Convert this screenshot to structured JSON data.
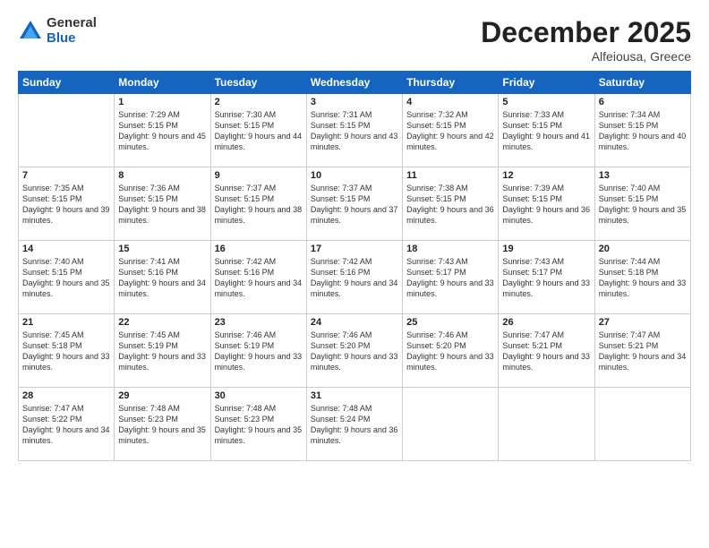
{
  "logo": {
    "general": "General",
    "blue": "Blue"
  },
  "title": "December 2025",
  "location": "Alfeiousa, Greece",
  "days_header": [
    "Sunday",
    "Monday",
    "Tuesday",
    "Wednesday",
    "Thursday",
    "Friday",
    "Saturday"
  ],
  "weeks": [
    [
      {
        "day": "",
        "sunrise": "",
        "sunset": "",
        "daylight": ""
      },
      {
        "day": "1",
        "sunrise": "Sunrise: 7:29 AM",
        "sunset": "Sunset: 5:15 PM",
        "daylight": "Daylight: 9 hours and 45 minutes."
      },
      {
        "day": "2",
        "sunrise": "Sunrise: 7:30 AM",
        "sunset": "Sunset: 5:15 PM",
        "daylight": "Daylight: 9 hours and 44 minutes."
      },
      {
        "day": "3",
        "sunrise": "Sunrise: 7:31 AM",
        "sunset": "Sunset: 5:15 PM",
        "daylight": "Daylight: 9 hours and 43 minutes."
      },
      {
        "day": "4",
        "sunrise": "Sunrise: 7:32 AM",
        "sunset": "Sunset: 5:15 PM",
        "daylight": "Daylight: 9 hours and 42 minutes."
      },
      {
        "day": "5",
        "sunrise": "Sunrise: 7:33 AM",
        "sunset": "Sunset: 5:15 PM",
        "daylight": "Daylight: 9 hours and 41 minutes."
      },
      {
        "day": "6",
        "sunrise": "Sunrise: 7:34 AM",
        "sunset": "Sunset: 5:15 PM",
        "daylight": "Daylight: 9 hours and 40 minutes."
      }
    ],
    [
      {
        "day": "7",
        "sunrise": "Sunrise: 7:35 AM",
        "sunset": "Sunset: 5:15 PM",
        "daylight": "Daylight: 9 hours and 39 minutes."
      },
      {
        "day": "8",
        "sunrise": "Sunrise: 7:36 AM",
        "sunset": "Sunset: 5:15 PM",
        "daylight": "Daylight: 9 hours and 38 minutes."
      },
      {
        "day": "9",
        "sunrise": "Sunrise: 7:37 AM",
        "sunset": "Sunset: 5:15 PM",
        "daylight": "Daylight: 9 hours and 38 minutes."
      },
      {
        "day": "10",
        "sunrise": "Sunrise: 7:37 AM",
        "sunset": "Sunset: 5:15 PM",
        "daylight": "Daylight: 9 hours and 37 minutes."
      },
      {
        "day": "11",
        "sunrise": "Sunrise: 7:38 AM",
        "sunset": "Sunset: 5:15 PM",
        "daylight": "Daylight: 9 hours and 36 minutes."
      },
      {
        "day": "12",
        "sunrise": "Sunrise: 7:39 AM",
        "sunset": "Sunset: 5:15 PM",
        "daylight": "Daylight: 9 hours and 36 minutes."
      },
      {
        "day": "13",
        "sunrise": "Sunrise: 7:40 AM",
        "sunset": "Sunset: 5:15 PM",
        "daylight": "Daylight: 9 hours and 35 minutes."
      }
    ],
    [
      {
        "day": "14",
        "sunrise": "Sunrise: 7:40 AM",
        "sunset": "Sunset: 5:15 PM",
        "daylight": "Daylight: 9 hours and 35 minutes."
      },
      {
        "day": "15",
        "sunrise": "Sunrise: 7:41 AM",
        "sunset": "Sunset: 5:16 PM",
        "daylight": "Daylight: 9 hours and 34 minutes."
      },
      {
        "day": "16",
        "sunrise": "Sunrise: 7:42 AM",
        "sunset": "Sunset: 5:16 PM",
        "daylight": "Daylight: 9 hours and 34 minutes."
      },
      {
        "day": "17",
        "sunrise": "Sunrise: 7:42 AM",
        "sunset": "Sunset: 5:16 PM",
        "daylight": "Daylight: 9 hours and 34 minutes."
      },
      {
        "day": "18",
        "sunrise": "Sunrise: 7:43 AM",
        "sunset": "Sunset: 5:17 PM",
        "daylight": "Daylight: 9 hours and 33 minutes."
      },
      {
        "day": "19",
        "sunrise": "Sunrise: 7:43 AM",
        "sunset": "Sunset: 5:17 PM",
        "daylight": "Daylight: 9 hours and 33 minutes."
      },
      {
        "day": "20",
        "sunrise": "Sunrise: 7:44 AM",
        "sunset": "Sunset: 5:18 PM",
        "daylight": "Daylight: 9 hours and 33 minutes."
      }
    ],
    [
      {
        "day": "21",
        "sunrise": "Sunrise: 7:45 AM",
        "sunset": "Sunset: 5:18 PM",
        "daylight": "Daylight: 9 hours and 33 minutes."
      },
      {
        "day": "22",
        "sunrise": "Sunrise: 7:45 AM",
        "sunset": "Sunset: 5:19 PM",
        "daylight": "Daylight: 9 hours and 33 minutes."
      },
      {
        "day": "23",
        "sunrise": "Sunrise: 7:46 AM",
        "sunset": "Sunset: 5:19 PM",
        "daylight": "Daylight: 9 hours and 33 minutes."
      },
      {
        "day": "24",
        "sunrise": "Sunrise: 7:46 AM",
        "sunset": "Sunset: 5:20 PM",
        "daylight": "Daylight: 9 hours and 33 minutes."
      },
      {
        "day": "25",
        "sunrise": "Sunrise: 7:46 AM",
        "sunset": "Sunset: 5:20 PM",
        "daylight": "Daylight: 9 hours and 33 minutes."
      },
      {
        "day": "26",
        "sunrise": "Sunrise: 7:47 AM",
        "sunset": "Sunset: 5:21 PM",
        "daylight": "Daylight: 9 hours and 33 minutes."
      },
      {
        "day": "27",
        "sunrise": "Sunrise: 7:47 AM",
        "sunset": "Sunset: 5:21 PM",
        "daylight": "Daylight: 9 hours and 34 minutes."
      }
    ],
    [
      {
        "day": "28",
        "sunrise": "Sunrise: 7:47 AM",
        "sunset": "Sunset: 5:22 PM",
        "daylight": "Daylight: 9 hours and 34 minutes."
      },
      {
        "day": "29",
        "sunrise": "Sunrise: 7:48 AM",
        "sunset": "Sunset: 5:23 PM",
        "daylight": "Daylight: 9 hours and 35 minutes."
      },
      {
        "day": "30",
        "sunrise": "Sunrise: 7:48 AM",
        "sunset": "Sunset: 5:23 PM",
        "daylight": "Daylight: 9 hours and 35 minutes."
      },
      {
        "day": "31",
        "sunrise": "Sunrise: 7:48 AM",
        "sunset": "Sunset: 5:24 PM",
        "daylight": "Daylight: 9 hours and 36 minutes."
      },
      {
        "day": "",
        "sunrise": "",
        "sunset": "",
        "daylight": ""
      },
      {
        "day": "",
        "sunrise": "",
        "sunset": "",
        "daylight": ""
      },
      {
        "day": "",
        "sunrise": "",
        "sunset": "",
        "daylight": ""
      }
    ]
  ]
}
